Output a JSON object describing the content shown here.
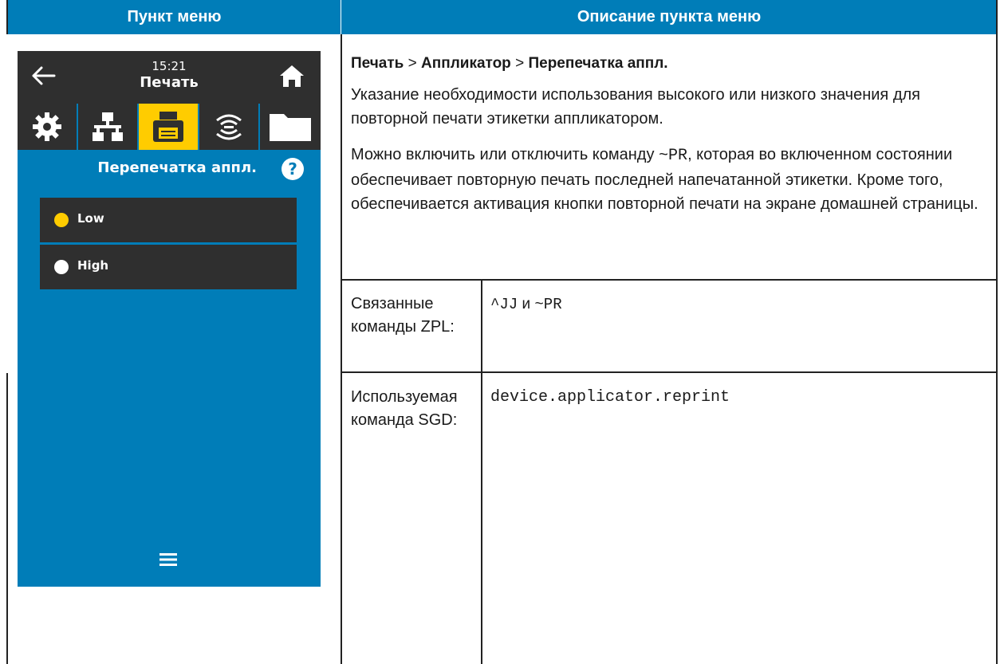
{
  "table": {
    "col1_header": "Пункт меню",
    "col2_header": "Описание пункта меню"
  },
  "screen": {
    "time": "15:21",
    "title": "Печать",
    "subtitle": "Перепечатка аппл.",
    "tabs": [
      "gear-icon",
      "network-icon",
      "printer-icon",
      "wireless-icon",
      "folder-icon"
    ],
    "active_tab": "printer-icon",
    "options": [
      {
        "label": "Low",
        "selected": true
      },
      {
        "label": "High",
        "selected": false
      }
    ],
    "colors": {
      "accent": "#007DB8",
      "bar": "#2f2f2f",
      "highlight": "#FFCC00"
    }
  },
  "description": {
    "crumb_1": "Печать",
    "crumb_sep": ">",
    "crumb_2": "Аппликатор",
    "crumb_3": "Перепечатка аппл.",
    "para1": "Указание необходимости использования высокого или низкого значения для повторной печати этикетки аппликатором.",
    "para2_a": "Можно включить или отключить команду ",
    "para2_cmd": "~PR",
    "para2_b": ", которая во включенном состоянии обеспечивает повторную печать последней напечатанной этикетки. Кроме того, обеспечивается активация кнопки повторной печати на экране домашней страницы.",
    "zpl_label": "Связанные команды ZPL:",
    "zpl_cmd1": "^JJ",
    "zpl_and": " и ",
    "zpl_cmd2": "~PR",
    "sgd_label": "Используемая команда SGD:",
    "sgd_value": "device.applicator.reprint"
  }
}
